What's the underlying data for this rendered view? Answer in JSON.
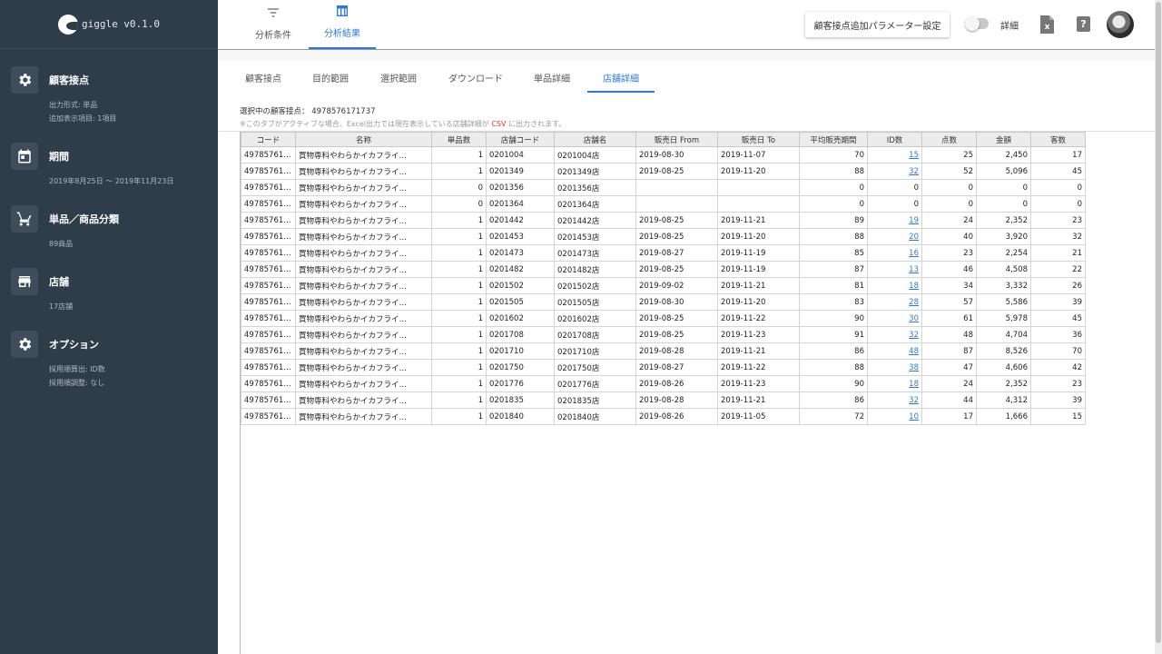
{
  "app": {
    "name": "giggle v0.1.0"
  },
  "sidebar": {
    "sections": [
      {
        "title": "顧客接点",
        "lines": [
          "出力形式: 単品",
          "追加表示項目: 1項目"
        ]
      },
      {
        "title": "期間",
        "lines": [
          "2019年8月25日 〜 2019年11月23日"
        ]
      },
      {
        "title": "単品／商品分類",
        "lines": [
          "89商品"
        ]
      },
      {
        "title": "店舗",
        "lines": [
          "17店舗"
        ]
      },
      {
        "title": "オプション",
        "lines": [
          "採用順算出: ID数",
          "採用順調整: なし"
        ]
      }
    ]
  },
  "header": {
    "tabs": [
      {
        "label": "分析条件"
      },
      {
        "label": "分析結果"
      }
    ],
    "param_button": "顧客接点追加パラメーター設定",
    "detail_label": "詳細",
    "help": "?"
  },
  "sub_tabs": [
    "顧客接点",
    "目的範囲",
    "選択範囲",
    "ダウンロード",
    "単品詳細",
    "店舗詳細"
  ],
  "info": {
    "selected_label": "選択中の顧客接点：",
    "selected_value": "4978576171737",
    "note_before": "※このタブがアクティブな場合、Excel出力では現在表示している店舗詳細が",
    "note_csv": "CSV",
    "note_after": "に出力されます。"
  },
  "table": {
    "headers": [
      "コード",
      "名称",
      "単品数",
      "店舗コード",
      "店舗名",
      "販売日 From",
      "販売日 To",
      "平均販売期間",
      "ID数",
      "点数",
      "金額",
      "客数"
    ],
    "rows": [
      [
        "49785761…",
        "買物専科やわらかイカフライ…",
        "1",
        "0201004",
        "0201004店",
        "2019-08-30",
        "2019-11-07",
        "70",
        "15",
        "25",
        "2,450",
        "17"
      ],
      [
        "49785761…",
        "買物専科やわらかイカフライ…",
        "1",
        "0201349",
        "0201349店",
        "2019-08-25",
        "2019-11-20",
        "88",
        "32",
        "52",
        "5,096",
        "45"
      ],
      [
        "49785761…",
        "買物専科やわらかイカフライ…",
        "0",
        "0201356",
        "0201356店",
        "",
        "",
        "0",
        "0",
        "0",
        "0",
        "0"
      ],
      [
        "49785761…",
        "買物専科やわらかイカフライ…",
        "0",
        "0201364",
        "0201364店",
        "",
        "",
        "0",
        "0",
        "0",
        "0",
        "0"
      ],
      [
        "49785761…",
        "買物専科やわらかイカフライ…",
        "1",
        "0201442",
        "0201442店",
        "2019-08-25",
        "2019-11-21",
        "89",
        "19",
        "24",
        "2,352",
        "23"
      ],
      [
        "49785761…",
        "買物専科やわらかイカフライ…",
        "1",
        "0201453",
        "0201453店",
        "2019-08-25",
        "2019-11-20",
        "88",
        "20",
        "40",
        "3,920",
        "32"
      ],
      [
        "49785761…",
        "買物専科やわらかイカフライ…",
        "1",
        "0201473",
        "0201473店",
        "2019-08-27",
        "2019-11-19",
        "85",
        "16",
        "23",
        "2,254",
        "21"
      ],
      [
        "49785761…",
        "買物専科やわらかイカフライ…",
        "1",
        "0201482",
        "0201482店",
        "2019-08-25",
        "2019-11-19",
        "87",
        "13",
        "46",
        "4,508",
        "22"
      ],
      [
        "49785761…",
        "買物専科やわらかイカフライ…",
        "1",
        "0201502",
        "0201502店",
        "2019-09-02",
        "2019-11-21",
        "81",
        "18",
        "34",
        "3,332",
        "26"
      ],
      [
        "49785761…",
        "買物専科やわらかイカフライ…",
        "1",
        "0201505",
        "0201505店",
        "2019-08-30",
        "2019-11-20",
        "83",
        "28",
        "57",
        "5,586",
        "39"
      ],
      [
        "49785761…",
        "買物専科やわらかイカフライ…",
        "1",
        "0201602",
        "0201602店",
        "2019-08-25",
        "2019-11-22",
        "90",
        "30",
        "61",
        "5,978",
        "45"
      ],
      [
        "49785761…",
        "買物専科やわらかイカフライ…",
        "1",
        "0201708",
        "0201708店",
        "2019-08-25",
        "2019-11-23",
        "91",
        "32",
        "48",
        "4,704",
        "36"
      ],
      [
        "49785761…",
        "買物専科やわらかイカフライ…",
        "1",
        "0201710",
        "0201710店",
        "2019-08-28",
        "2019-11-21",
        "86",
        "48",
        "87",
        "8,526",
        "70"
      ],
      [
        "49785761…",
        "買物専科やわらかイカフライ…",
        "1",
        "0201750",
        "0201750店",
        "2019-08-27",
        "2019-11-22",
        "88",
        "38",
        "47",
        "4,606",
        "42"
      ],
      [
        "49785761…",
        "買物専科やわらかイカフライ…",
        "1",
        "0201776",
        "0201776店",
        "2019-08-26",
        "2019-11-23",
        "90",
        "18",
        "24",
        "2,352",
        "23"
      ],
      [
        "49785761…",
        "買物専科やわらかイカフライ…",
        "1",
        "0201835",
        "0201835店",
        "2019-08-28",
        "2019-11-21",
        "86",
        "32",
        "44",
        "4,312",
        "39"
      ],
      [
        "49785761…",
        "買物専科やわらかイカフライ…",
        "1",
        "0201840",
        "0201840店",
        "2019-08-26",
        "2019-11-05",
        "72",
        "10",
        "17",
        "1,666",
        "15"
      ]
    ]
  }
}
